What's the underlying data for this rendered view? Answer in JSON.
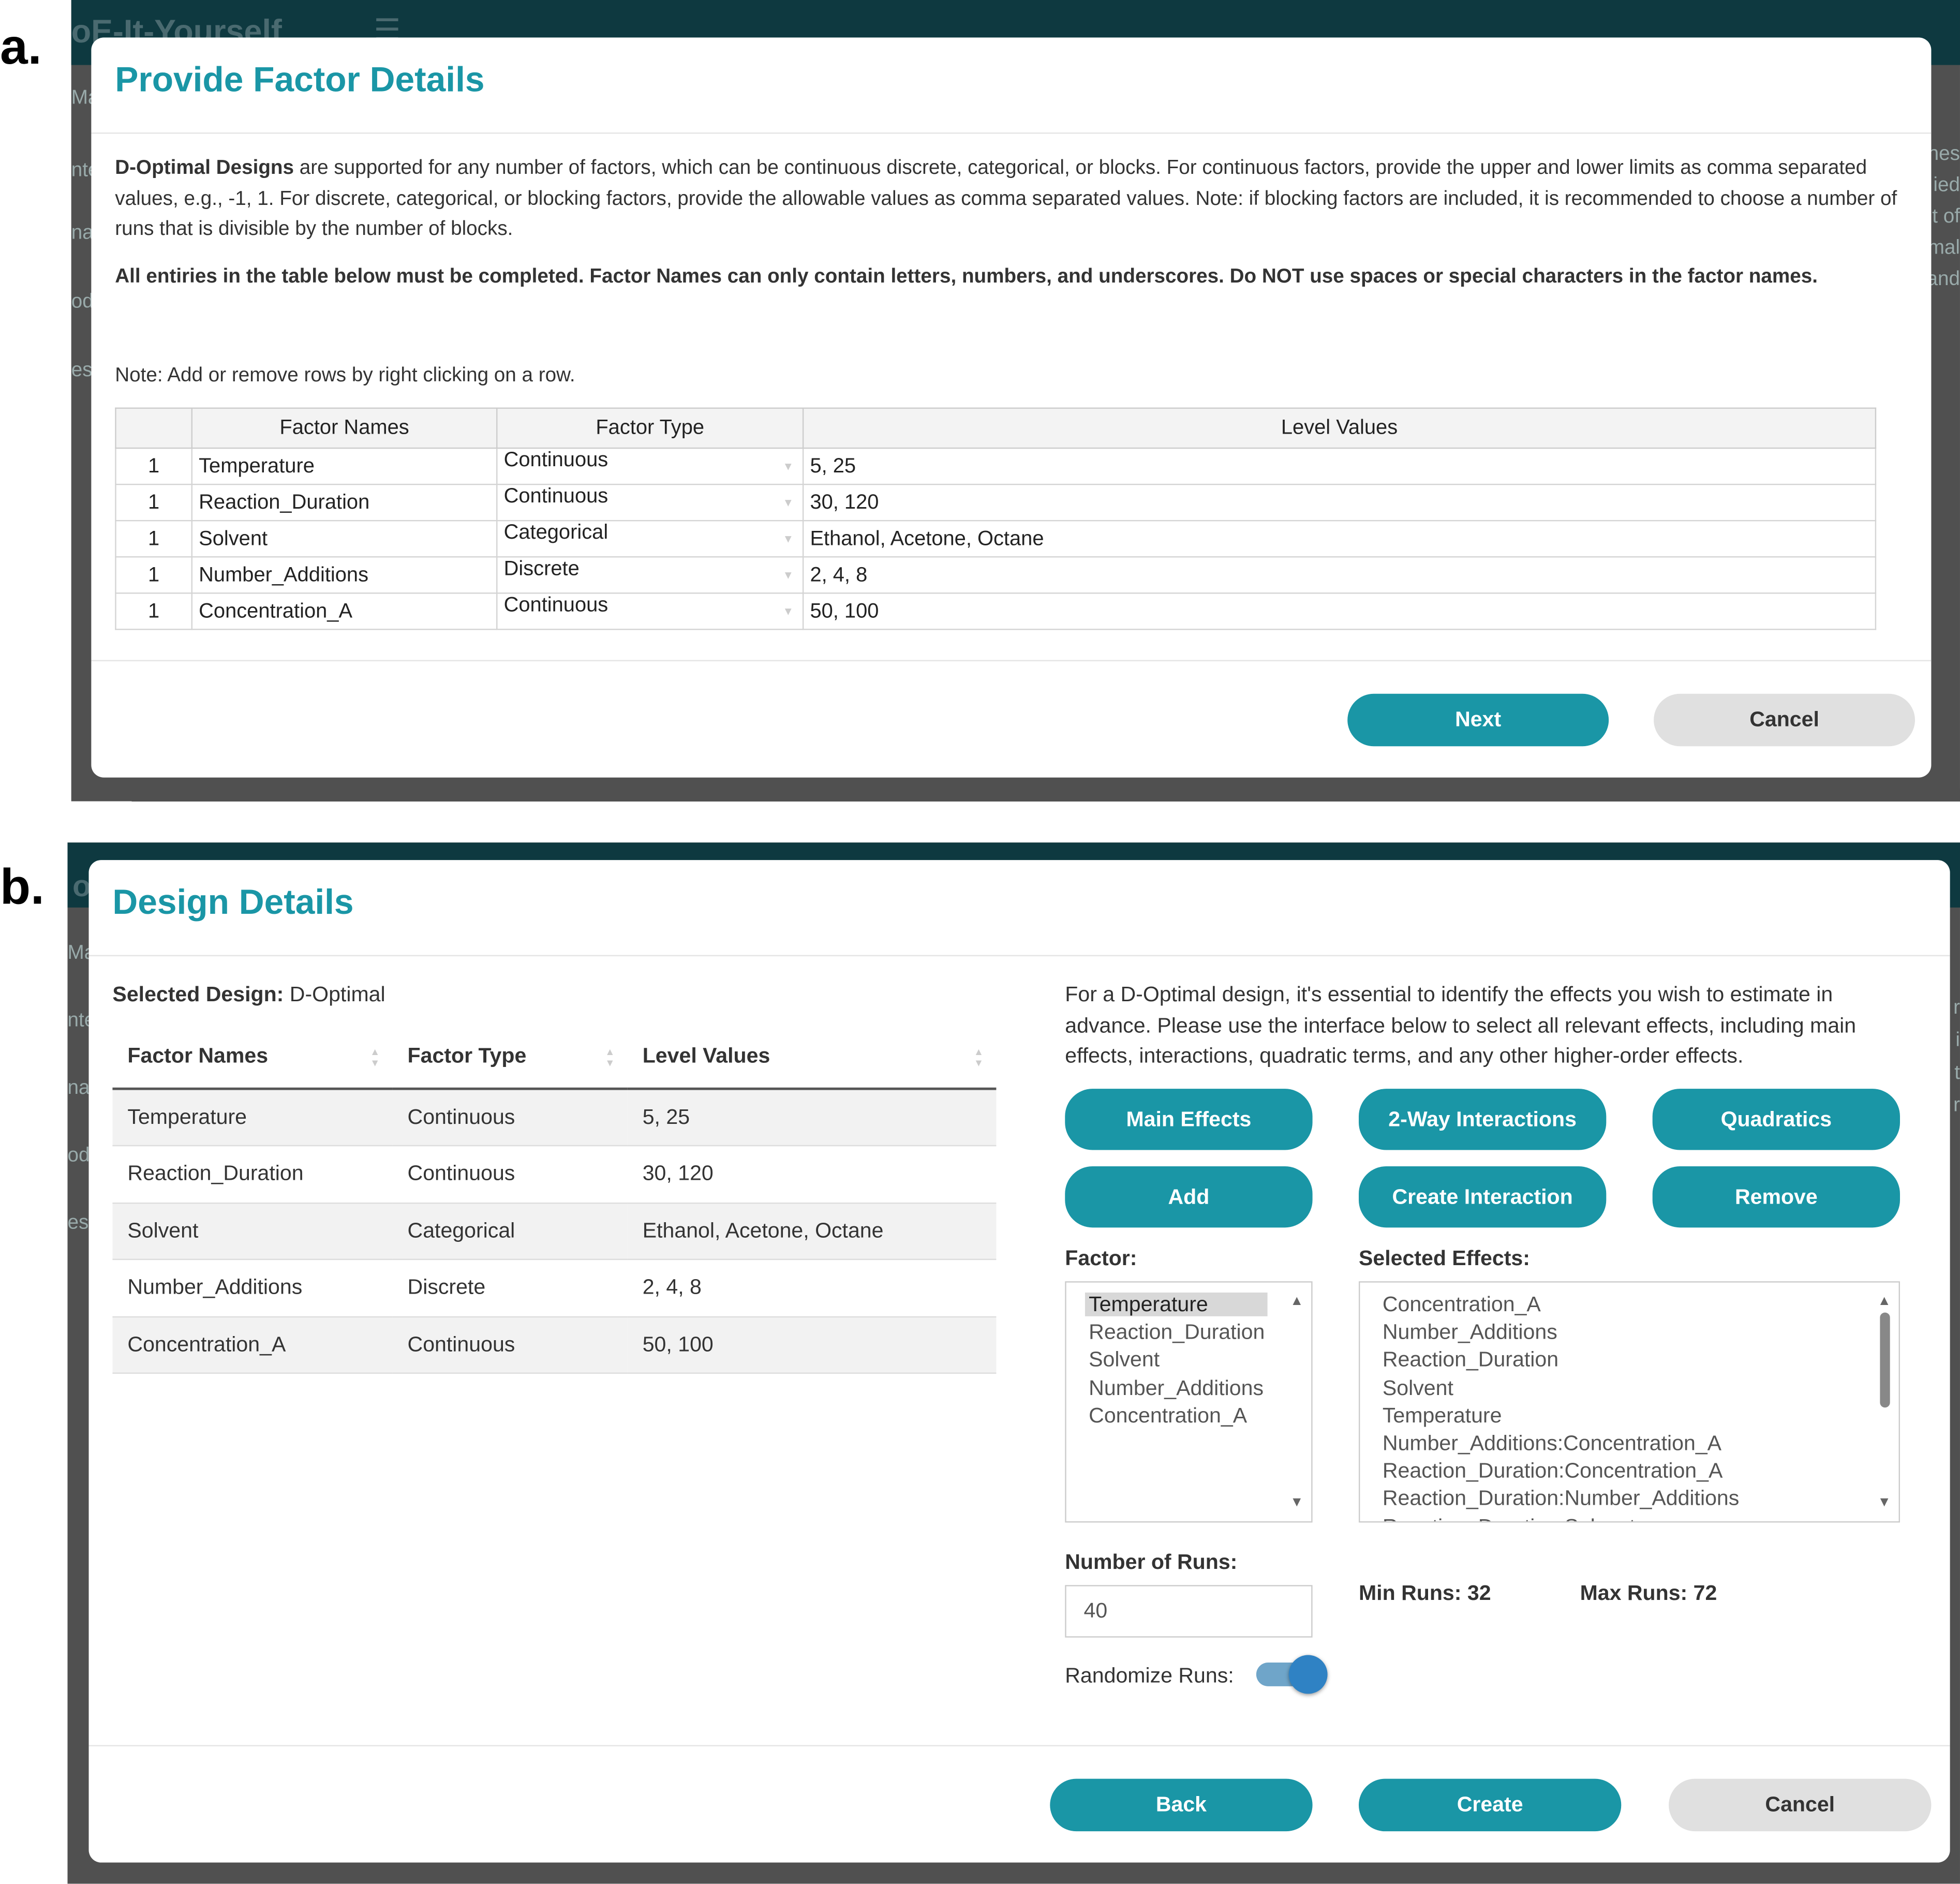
{
  "panel_a": {
    "label": "a.",
    "bg": {
      "app_title": "oE-It-Yourself",
      "menu_icon": "☰",
      "left_frags": [
        "Mal",
        "nte",
        "na",
        "od",
        "es"
      ],
      "right_frags": [
        "nes",
        "ied",
        "t of",
        "mal",
        "and"
      ]
    },
    "title": "Provide Factor Details",
    "desc_bold": "D-Optimal Designs",
    "desc_rest": " are supported for any number of factors, which can be continuous discrete, categorical, or blocks. For continuous factors, provide the upper and lower limits as comma separated values, e.g., -1, 1. For discrete, categorical, or blocking factors, provide the allowable values as comma separated values. Note: if blocking factors are included, it is recommended to choose a number of runs that is divisible by the number of blocks.",
    "warning": "All entiries in the table below must be completed. Factor Names can only contain letters, numbers, and underscores. Do NOT use spaces or special characters in the factor names.",
    "note": "Note: Add or remove rows by right clicking on a row.",
    "headers": [
      "",
      "Factor Names",
      "Factor Type",
      "Level Values"
    ],
    "rows": [
      {
        "n": "1",
        "name": "Temperature",
        "type": "Continuous",
        "levels": "5, 25"
      },
      {
        "n": "1",
        "name": "Reaction_Duration",
        "type": "Continuous",
        "levels": "30, 120"
      },
      {
        "n": "1",
        "name": "Solvent",
        "type": "Categorical",
        "levels": "Ethanol, Acetone, Octane"
      },
      {
        "n": "1",
        "name": "Number_Additions",
        "type": "Discrete",
        "levels": "2, 4, 8"
      },
      {
        "n": "1",
        "name": "Concentration_A",
        "type": "Continuous",
        "levels": "50, 100"
      }
    ],
    "dropdown_icon": "▼",
    "next": "Next",
    "cancel": "Cancel"
  },
  "panel_b": {
    "label": "b.",
    "bg": {
      "app_title": "o",
      "left_frags": [
        "Mal",
        "nte",
        "na",
        "od",
        "es"
      ],
      "right_frags": [
        "r",
        "i",
        "t",
        "r"
      ]
    },
    "title": "Design Details",
    "selected_label": "Selected Design:",
    "selected_value": " D-Optimal",
    "headers": [
      "Factor Names",
      "Factor Type",
      "Level Values"
    ],
    "sort_icon": "▲▼",
    "rows": [
      {
        "name": "Temperature",
        "type": "Continuous",
        "levels": "5, 25"
      },
      {
        "name": "Reaction_Duration",
        "type": "Continuous",
        "levels": "30, 120"
      },
      {
        "name": "Solvent",
        "type": "Categorical",
        "levels": "Ethanol, Acetone, Octane"
      },
      {
        "name": "Number_Additions",
        "type": "Discrete",
        "levels": "2, 4, 8"
      },
      {
        "name": "Concentration_A",
        "type": "Continuous",
        "levels": "50, 100"
      }
    ],
    "info": "For a D-Optimal design, it's essential to identify the effects you wish to estimate in advance. Please use the interface below to select all relevant effects, including main effects, interactions, quadratic terms, and any other higher-order effects.",
    "buttons": {
      "main_effects": "Main Effects",
      "two_way": "2-Way Interactions",
      "quadratics": "Quadratics",
      "add": "Add",
      "create_interaction": "Create Interaction",
      "remove": "Remove"
    },
    "factor_label": "Factor:",
    "factor_items": [
      "Temperature",
      "Reaction_Duration",
      "Solvent",
      "Number_Additions",
      "Concentration_A"
    ],
    "selected_factor": "Temperature",
    "effects_label": "Selected Effects:",
    "effects_items": [
      "Concentration_A",
      "Number_Additions",
      "Reaction_Duration",
      "Solvent",
      "Temperature",
      "Number_Additions:Concentration_A",
      "Reaction_Duration:Concentration_A",
      "Reaction_Duration:Number_Additions",
      "Reaction_Duration:Solvent"
    ],
    "scroll_up_icon": "▲",
    "scroll_down_icon": "▼",
    "runs_label": "Number of Runs:",
    "runs_value": "40",
    "min_runs": "Min Runs: 32",
    "max_runs": "Max Runs: 72",
    "randomize_label": "Randomize Runs:",
    "randomize_on": true,
    "back": "Back",
    "create": "Create",
    "cancel": "Cancel"
  },
  "colors": {
    "accent": "#1a96a6",
    "app_bar": "#0e3940",
    "toggle": "#2f82c4"
  }
}
